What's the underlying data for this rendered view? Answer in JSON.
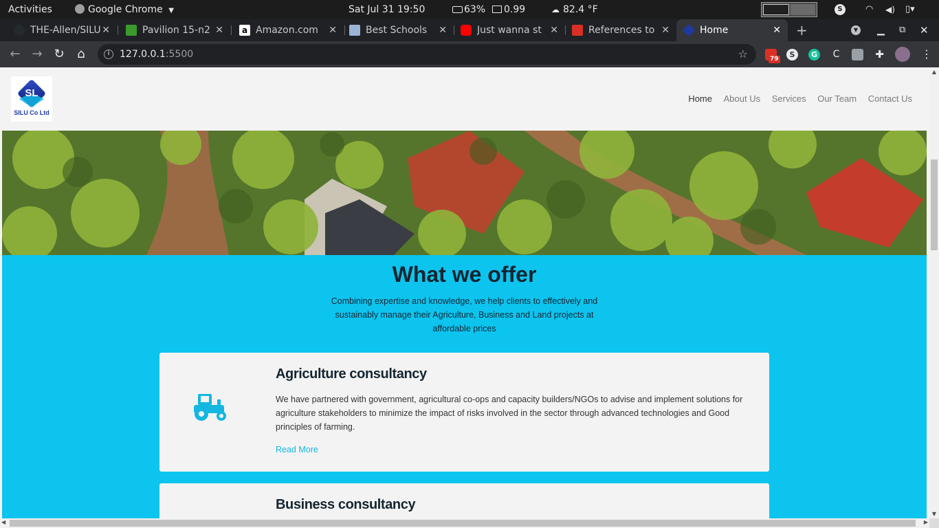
{
  "system_bar": {
    "activities": "Activities",
    "app_name": "Google Chrome",
    "clock": "Sat Jul 31  19:50",
    "battery": "63%",
    "load": "0.99",
    "weather": "82.4 °F"
  },
  "tabs": [
    {
      "title": "THE-Allen/SILU",
      "favicon_color": "#24292e"
    },
    {
      "title": "Pavilion 15-n2",
      "favicon_color": "#3c9a2c"
    },
    {
      "title": "Amazon.com",
      "favicon_color": "#ffffff"
    },
    {
      "title": "Best Schools I",
      "favicon_color": "#9ab4d8"
    },
    {
      "title": "Just wanna st",
      "favicon_color": "#ff0000"
    },
    {
      "title": "References to",
      "favicon_color": "#d93025"
    },
    {
      "title": "Home",
      "favicon_color": "#1e3aa0"
    }
  ],
  "omnibox": {
    "url_host": "127.0.0.1",
    "url_port": ":5500"
  },
  "extensions": {
    "badge_count": "79"
  },
  "site": {
    "logo_text": "SL",
    "logo_name": "SILU Co Ltd",
    "nav": [
      "Home",
      "About Us",
      "Services",
      "Our Team",
      "Contact Us"
    ],
    "accent": "#0dc4ef",
    "offer": {
      "title": "What we offer",
      "subtitle": "Combining expertise and knowledge, we help clients to effectively and sustainably manage their Agriculture, Business and Land projects at affordable prices"
    },
    "cards": [
      {
        "title": "Agriculture consultancy",
        "body": "We have partnered with government, agricultural co-ops and capacity builders/NGOs to advise and implement solutions for agriculture stakeholders to minimize the impact of risks involved in the sector through advanced technologies and Good principles of farming.",
        "link": "Read More",
        "icon": "tractor-icon"
      },
      {
        "title": "Business consultancy"
      }
    ]
  }
}
